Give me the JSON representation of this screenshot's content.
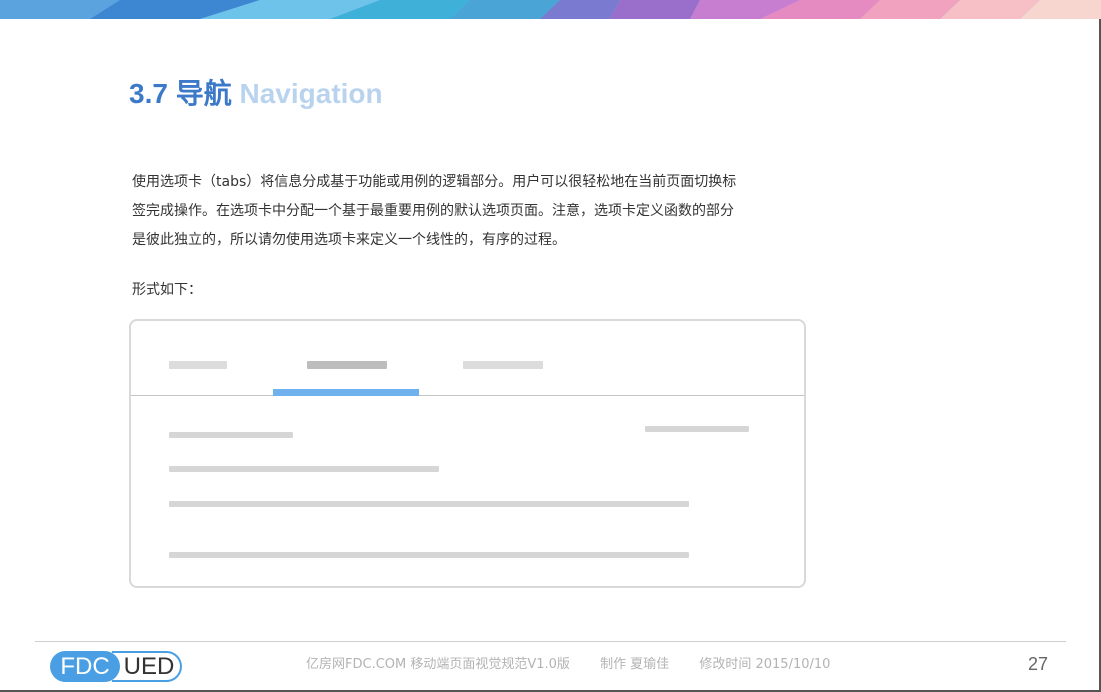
{
  "header": {
    "number": "3.7 导航",
    "english": "Navigation"
  },
  "body": {
    "lines": [
      "使用选项卡（tabs）将信息分成基于功能或用例的逻辑部分。用户可以很轻松地在当前页面切换标",
      "签完成操作。在选项卡中分配一个基于最重要用例的默认选项页面。注意，选项卡定义函数的部分",
      "是彼此独立的，所以请勿使用选项卡来定义一个线性的，有序的过程。"
    ],
    "form_label": "形式如下："
  },
  "colors": {
    "title_accent": "#3d79c9",
    "title_english": "#b9d3ef",
    "tab_indicator": "#6fb1ec",
    "logo_blue": "#4a9fe4"
  },
  "footer": {
    "logo_left": "FDC",
    "logo_right": "UED",
    "doc_name": "亿房网FDC.COM 移动端页面视觉规范V1.0版",
    "author": "制作 夏瑜佳",
    "modified": "修改时间  2015/10/10",
    "page_number": "27"
  }
}
